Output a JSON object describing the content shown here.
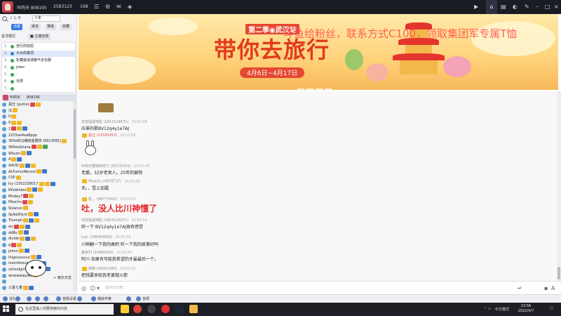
{
  "titlebar": {
    "stats": [
      "叫鸡天 808195",
      "2583123",
      "168"
    ],
    "icons": [
      "tv-icon",
      "home-icon",
      "message-icon",
      "gamepad-icon",
      "skin-icon",
      "minimize-icon",
      "maximize-icon",
      "close-icon"
    ]
  },
  "leftpanel": {
    "search_placeholder": "十年",
    "tab_labels": [
      "点歌",
      "歌单",
      "推歌",
      "收藏"
    ],
    "mode_label": "星洋模式",
    "mode_button": "■ 主播音频",
    "songs": [
      {
        "n": "1.",
        "t": "自行的别扭",
        "selected": false
      },
      {
        "n": "2.",
        "t": "大水的歌词",
        "selected": true
      },
      {
        "n": "3.",
        "t": "牝藏最浪漫懈气去也罢",
        "selected": false
      },
      {
        "n": "4.",
        "t": "jokor",
        "selected": false
      },
      {
        "n": "5.",
        "t": "·",
        "selected": false
      },
      {
        "n": "6.",
        "t": "无限",
        "selected": false
      },
      {
        "n": "7.",
        "t": "",
        "selected": false
      }
    ],
    "user_header": {
      "name": "叫鸡天",
      "id": "808195"
    },
    "users": [
      {
        "name": "黑仕 (guitio)",
        "badges": [
          "red",
          "gold"
        ]
      },
      {
        "name": "冯",
        "badges": [
          "gold"
        ]
      },
      {
        "name": "0",
        "badges": [
          "gold"
        ]
      },
      {
        "name": "0",
        "badges": [
          "gold",
          "gold"
        ]
      },
      {
        "name": "1",
        "badges": [
          "red",
          "gold",
          "blue"
        ]
      },
      {
        "name": "2225ee4aa8ppp",
        "badges": []
      },
      {
        "name": "300e的马桶房屋服饰 (8913081)",
        "badges": [
          "gold"
        ]
      },
      {
        "name": "99Peo&hana",
        "badges": [
          "red",
          "gold",
          "green"
        ]
      },
      {
        "name": "Wkyen",
        "badges": [
          "gold",
          "blue"
        ]
      },
      {
        "name": "A",
        "badges": [
          "gold",
          "blue"
        ]
      },
      {
        "name": "AADD",
        "badges": [
          "gold",
          "blue",
          "gold"
        ]
      },
      {
        "name": "ALFuriouWorval",
        "badges": [
          "gold",
          "blue"
        ]
      },
      {
        "name": "CSP",
        "badges": [
          "gold"
        ]
      },
      {
        "name": "Icy (1352238017",
        "badges": [
          "gold",
          "gold",
          "blue"
        ]
      },
      {
        "name": "KKddrides",
        "badges": [
          "gold",
          "blue",
          "gold"
        ]
      },
      {
        "name": "Mickey7",
        "badges": [
          "red",
          "gold"
        ]
      },
      {
        "name": "Pikachu",
        "badges": [
          "red",
          "gold"
        ]
      },
      {
        "name": "Slowrun",
        "badges": [
          "gold"
        ]
      },
      {
        "name": "SpikeDlynt",
        "badges": [
          "gold",
          "blue"
        ]
      },
      {
        "name": "Triumph",
        "badges": [
          "gold",
          "blue",
          "gold"
        ]
      },
      {
        "name": "ws",
        "badges": [
          "red",
          "gold",
          "blue"
        ]
      },
      {
        "name": "ddBy",
        "badges": [
          "gold",
          "blue"
        ]
      },
      {
        "name": "divide",
        "badges": [
          "gold",
          "blue",
          "gold"
        ]
      },
      {
        "name": "g",
        "badges": [
          "red",
          "gold"
        ]
      },
      {
        "name": "johnn",
        "badges": [
          "gold",
          "blue"
        ]
      },
      {
        "name": "lingsuuuuuo",
        "badges": [
          "gold",
          "blue"
        ]
      },
      {
        "name": "noonforever",
        "badges": [
          "gold",
          "gold",
          "blue"
        ]
      },
      {
        "name": "schoolgirl hyvhon",
        "badges": [
          "gold",
          "blue"
        ]
      },
      {
        "name": "wnwwwwywo",
        "badges": [
          "gold"
        ]
      },
      {
        "name": "",
        "badges": []
      },
      {
        "name": "三夏七香",
        "badges": [
          "gold",
          "blue"
        ]
      }
    ],
    "sticker_tip": "+ 嘴天天送"
  },
  "banner": {
    "season": "第二季◉武汉站",
    "title": "带你去旅行",
    "date": "4月6日~4月17日",
    "overlay": "斗鱼给粉丝，联系方式C100，领取集团军专属T恤"
  },
  "chat": {
    "messages": [
      {
        "name": "无双猛戒电影 (1813124671)",
        "time": "23:53:09",
        "body": "应景的歌BV12q4y1e7AJ",
        "badge": false,
        "red": false,
        "big": false
      },
      {
        "name": "黑仕 (31595453)",
        "time": "23:53:58",
        "body": "",
        "badge": true,
        "red": true,
        "big": false
      },
      {
        "name": "叫鸡天要搞到死了 (50720251)",
        "time": "23:53:45",
        "body": "老爵。32岁老男人。25年的聊狗",
        "badge": false,
        "red": false,
        "big": false
      },
      {
        "name": "Pikachu (4978737)",
        "time": "23:53:20",
        "body": "天。，雪上加霜",
        "badge": true,
        "red": false,
        "big": false
      },
      {
        "name": "氪。 (98777002)",
        "time": "23:53:53",
        "body": "吐，没人比川神懂了",
        "badge": true,
        "red": false,
        "big": true
      },
      {
        "name": "无双猛戒电影 (1813124671)",
        "time": "23:54:54",
        "body": "听一下 BV12q4y1e7AJ很有感觉",
        "badge": false,
        "red": false,
        "big": false
      },
      {
        "name": "Icyc (298463659)",
        "time": "23:55:24",
        "body": "川神翻一下我的曲吧 听一下我的故事好吗",
        "badge": false,
        "red": false,
        "big": false
      },
      {
        "name": "秦家村 (29990300)",
        "time": "23:55:47",
        "body": "阿川 如果有可能我希望的才最最后一个。",
        "badge": false,
        "red": false,
        "big": false
      },
      {
        "name": "搞种 (34302283)",
        "time": "23:55:52",
        "body": "把钱要来给我老婆做火箭",
        "badge": true,
        "red": false,
        "big": false
      }
    ]
  },
  "inputbar": {
    "placeholder": "说点什么吧..."
  },
  "toolbar": {
    "items": [
      "送礼",
      "",
      "",
      "",
      "",
      "答题设置",
      "",
      "播放伴奏",
      "",
      "音频"
    ]
  },
  "taskbar": {
    "search_placeholder": "在这里输入你要搜索的内容",
    "tray_label": "中文模式",
    "time": "23:56",
    "date": "2022/4/7"
  }
}
